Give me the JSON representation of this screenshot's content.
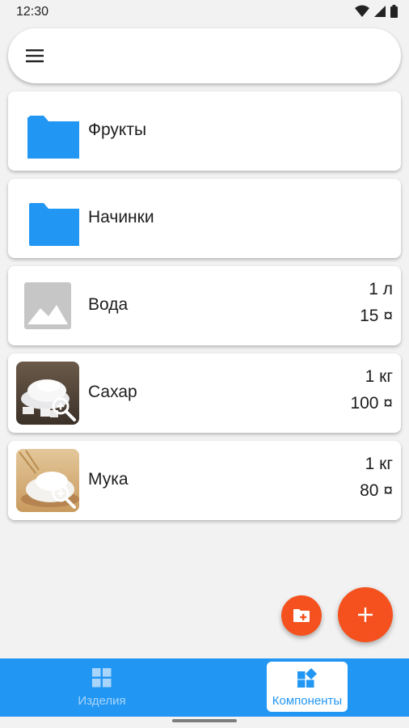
{
  "status": {
    "time": "12:30"
  },
  "colors": {
    "accent": "#2196f3",
    "fab": "#f4511e",
    "folder": "#2196f3"
  },
  "items": [
    {
      "type": "folder",
      "title": "Фрукты"
    },
    {
      "type": "folder",
      "title": "Начинки"
    },
    {
      "type": "placeholder",
      "title": "Вода",
      "qty": "1 л",
      "price": "15 ¤"
    },
    {
      "type": "photo",
      "photo": "sugar",
      "title": "Сахар",
      "qty": "1 кг",
      "price": "100 ¤"
    },
    {
      "type": "photo",
      "photo": "flour",
      "title": "Мука",
      "qty": "1 кг",
      "price": "80 ¤"
    }
  ],
  "fab": {
    "small_icon": "add-folder-icon",
    "large_icon": "plus-icon"
  },
  "nav": {
    "tabs": [
      {
        "label": "Изделия",
        "icon": "dashboard-icon",
        "selected": false
      },
      {
        "label": "Компоненты",
        "icon": "widgets-icon",
        "selected": true
      }
    ]
  }
}
